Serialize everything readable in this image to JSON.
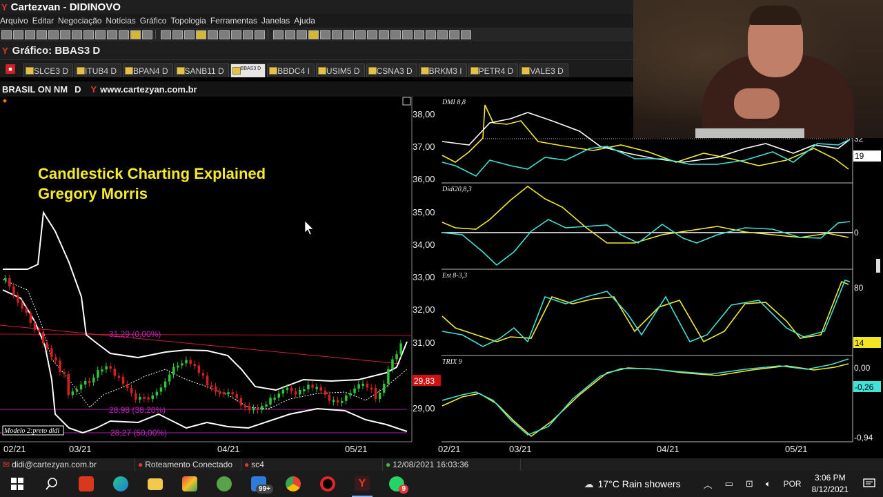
{
  "window": {
    "title": "Cartezvan - DIDINOVO"
  },
  "menu": [
    "Arquivo",
    "Editar",
    "Negociação",
    "Notícias",
    "Gráfico",
    "Topologia",
    "Ferramentas",
    "Janelas",
    "Ajuda"
  ],
  "chart_window": {
    "title": "Gráfico: BBAS3 D"
  },
  "tabs": [
    {
      "label": "SLCE3 D"
    },
    {
      "label": "ITUB4 D"
    },
    {
      "label": "BPAN4 D"
    },
    {
      "label": "SANB11 D"
    },
    {
      "label": "BBAS3 D",
      "active": true
    },
    {
      "label": "BBDC4 I"
    },
    {
      "label": "USIM5 D"
    },
    {
      "label": "CSNA3 D"
    },
    {
      "label": "BRKM3 I"
    },
    {
      "label": "PETR4 D"
    },
    {
      "label": "VALE3 D"
    }
  ],
  "symbol_bar": {
    "name": "BRASIL ON NM",
    "timeframe": "D",
    "site": "www.cartezyan.com.br"
  },
  "overlay": {
    "line1": "Candlestick Charting Explained",
    "line2": "Gregory Morris"
  },
  "price_chart": {
    "y_ticks": [
      "38,00",
      "37,00",
      "36,00",
      "35,00",
      "34,00",
      "33,00",
      "32,00",
      "31,00",
      "29,00"
    ],
    "x_ticks": [
      "02/21",
      "03/21",
      "04/21",
      "05/21"
    ],
    "current_price": "29,83",
    "fib_levels": [
      "31,29 (0,00%)",
      "28,98 (38,20%)",
      "28,27 (50,00%)"
    ],
    "model_label": "Modelo 2:preto didi"
  },
  "indicators": [
    {
      "name": "DMI 8,8",
      "values": [
        "32",
        "19"
      ]
    },
    {
      "name": "Didi20,8,3",
      "values": [
        "0"
      ]
    },
    {
      "name": "Est 8-3,3",
      "values": [
        "80",
        "14"
      ]
    },
    {
      "name": "TRIX 9",
      "values": [
        "0,00",
        "-0,26",
        "-0,94"
      ]
    }
  ],
  "indicator_x_ticks": [
    "02/21",
    "03/21",
    "04/21",
    "05/21"
  ],
  "chart_data": [
    {
      "type": "line",
      "title": "DMI 8,8",
      "x": [
        "02/21",
        "03/21",
        "04/21",
        "05/21"
      ],
      "series": [
        {
          "values": [
            20,
            42,
            22,
            24,
            32
          ]
        },
        {
          "values": [
            28,
            40,
            30,
            22,
            28
          ]
        },
        {
          "values": [
            14,
            10,
            18,
            16,
            32
          ]
        }
      ]
    },
    {
      "type": "line",
      "title": "Est 8-3,3",
      "series": [
        {
          "values": [
            50,
            20,
            85,
            80,
            20,
            88,
            20,
            80,
            20,
            92
          ]
        },
        {
          "values": [
            55,
            18,
            80,
            84,
            25,
            85,
            25,
            82,
            22,
            90
          ]
        }
      ]
    }
  ],
  "status_bar": {
    "email": "didi@cartezyan.com.br",
    "routing": "Roteamento Conectado",
    "server": "sc4",
    "datetime": "12/08/2021 16:03:36"
  },
  "taskbar": {
    "mail_badge": "99+",
    "whatsapp_badge": "9",
    "weather": "17°C  Rain showers",
    "language": "POR",
    "time": "3:06 PM",
    "date": "8/12/2021"
  }
}
